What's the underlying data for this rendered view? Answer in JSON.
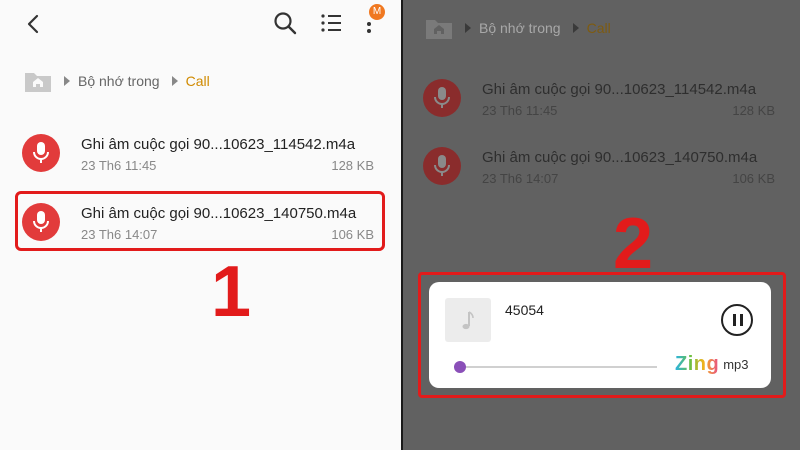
{
  "left_panel": {
    "breadcrumb": {
      "root": "Bộ nhớ trong",
      "current": "Call"
    },
    "more_badge": "M",
    "files": [
      {
        "name": "Ghi âm cuộc gọi 90...10623_114542.m4a",
        "date": "23 Th6 11:45",
        "size": "128 KB"
      },
      {
        "name": "Ghi âm cuộc gọi 90...10623_140750.m4a",
        "date": "23 Th6 14:07",
        "size": "106 KB"
      }
    ],
    "step_label": "1"
  },
  "right_panel": {
    "breadcrumb": {
      "root": "Bộ nhớ trong",
      "current": "Call"
    },
    "files": [
      {
        "name": "Ghi âm cuộc gọi 90...10623_114542.m4a",
        "date": "23 Th6 11:45",
        "size": "128 KB"
      },
      {
        "name": "Ghi âm cuộc gọi 90...10623_140750.m4a",
        "date": "23 Th6 14:07",
        "size": "106 KB"
      }
    ],
    "step_label": "2",
    "player": {
      "track_title": "45054",
      "progress": 0,
      "brand_zing": "Zing",
      "brand_mp3": "mp3"
    }
  },
  "colors": {
    "accent_red": "#e21b1b",
    "file_icon_red": "#e23b3b",
    "breadcrumb_current": "#d08a00",
    "progress_thumb": "#8a4fb8",
    "badge_orange": "#f07820"
  },
  "icons": [
    "back-icon",
    "search-icon",
    "list-view-icon",
    "more-vert-icon",
    "folder-home-icon",
    "microphone-icon",
    "music-note-icon",
    "pause-icon"
  ]
}
